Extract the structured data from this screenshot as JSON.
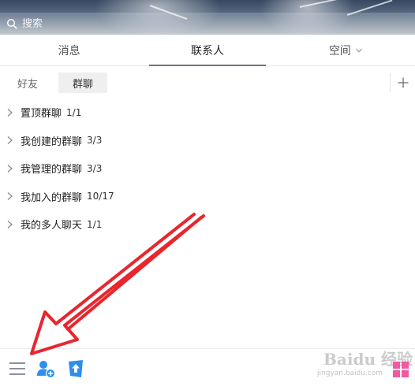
{
  "search": {
    "placeholder": "搜索"
  },
  "tabs": [
    {
      "label": "消息",
      "active": false
    },
    {
      "label": "联系人",
      "active": true
    },
    {
      "label": "空间",
      "active": false
    }
  ],
  "subtabs": [
    {
      "label": "好友",
      "active": false
    },
    {
      "label": "群聊",
      "active": true
    }
  ],
  "groups": [
    {
      "name": "置顶群聊",
      "count": "1/1"
    },
    {
      "name": "我创建的群聊",
      "count": "3/3"
    },
    {
      "name": "我管理的群聊",
      "count": "3/3"
    },
    {
      "name": "我加入的群聊",
      "count": "10/17"
    },
    {
      "name": "我的多人聊天",
      "count": "1/1"
    }
  ],
  "bottombar": {
    "icons": [
      "menu-icon",
      "add-friend-icon",
      "file-transfer-icon"
    ]
  },
  "watermark": {
    "brand": "Baidu 经验",
    "url": "jingyan.baidu.com"
  },
  "colors": {
    "accent_blue": "#2b8ef0",
    "arrow_red": "#e8262d",
    "tab_underline": "#6d7682",
    "subtab_bg": "#efefef"
  }
}
